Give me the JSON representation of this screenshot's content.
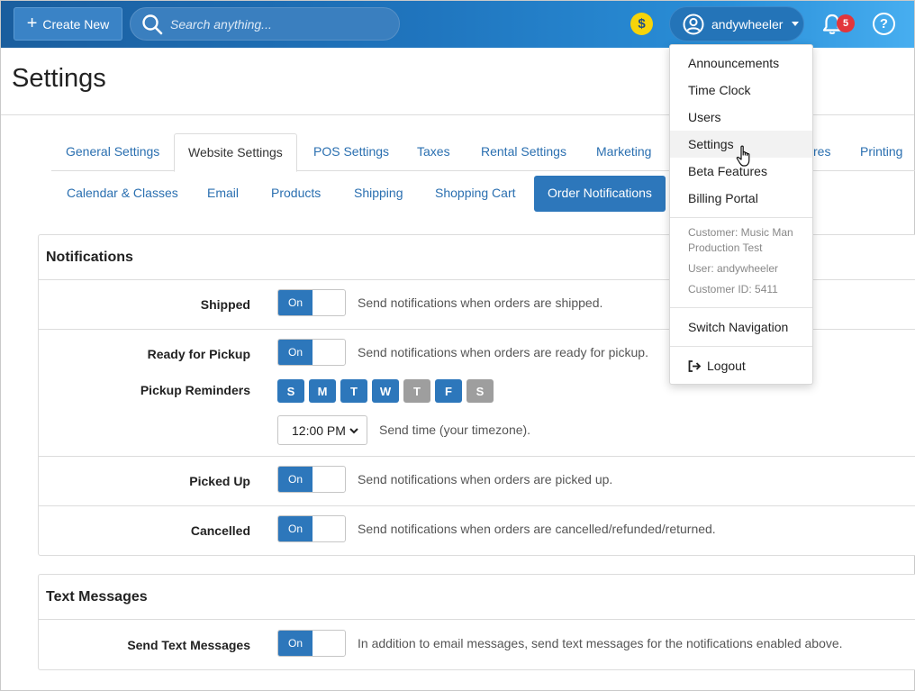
{
  "topbar": {
    "create_label": "Create New",
    "search_placeholder": "Search anything...",
    "coin_symbol": "$",
    "username": "andywheeler",
    "notification_count": "5",
    "help_symbol": "?"
  },
  "page": {
    "title": "Settings"
  },
  "tabs": [
    {
      "label": "General Settings"
    },
    {
      "label": "Website Settings"
    },
    {
      "label": "POS Settings"
    },
    {
      "label": "Taxes"
    },
    {
      "label": "Rental Settings"
    },
    {
      "label": "Marketing"
    },
    {
      "label": "res"
    },
    {
      "label": "Printing"
    }
  ],
  "subtabs": [
    {
      "label": "Calendar & Classes"
    },
    {
      "label": "Email"
    },
    {
      "label": "Products"
    },
    {
      "label": "Shipping"
    },
    {
      "label": "Shopping Cart"
    },
    {
      "label": "Order Notifications"
    }
  ],
  "notifications": {
    "title": "Notifications",
    "shipped": {
      "label": "Shipped",
      "toggle": "On",
      "desc": "Send notifications when orders are shipped."
    },
    "ready": {
      "label": "Ready for Pickup",
      "toggle": "On",
      "desc": "Send notifications when orders are ready for pickup."
    },
    "reminders": {
      "label": "Pickup Reminders",
      "days": [
        "S",
        "M",
        "T",
        "W",
        "T",
        "F",
        "S"
      ],
      "time_value": "12:00 PM",
      "time_desc": "Send time (your timezone)."
    },
    "picked": {
      "label": "Picked Up",
      "toggle": "On",
      "desc": "Send notifications when orders are picked up."
    },
    "cancelled": {
      "label": "Cancelled",
      "toggle": "On",
      "desc": "Send notifications when orders are cancelled/refunded/returned."
    }
  },
  "text_messages": {
    "title": "Text Messages",
    "send": {
      "label": "Send Text Messages",
      "toggle": "On",
      "desc": "In addition to email messages, send text messages for the notifications enabled above."
    }
  },
  "menu": {
    "items": [
      "Announcements",
      "Time Clock",
      "Users",
      "Settings",
      "Beta Features",
      "Billing Portal"
    ],
    "customer_line1": "Customer: Music Man",
    "customer_line2": "Production Test",
    "user_line": "User: andywheeler",
    "customer_id": "Customer ID: 5411",
    "switch_nav": "Switch Navigation",
    "logout": "Logout"
  }
}
